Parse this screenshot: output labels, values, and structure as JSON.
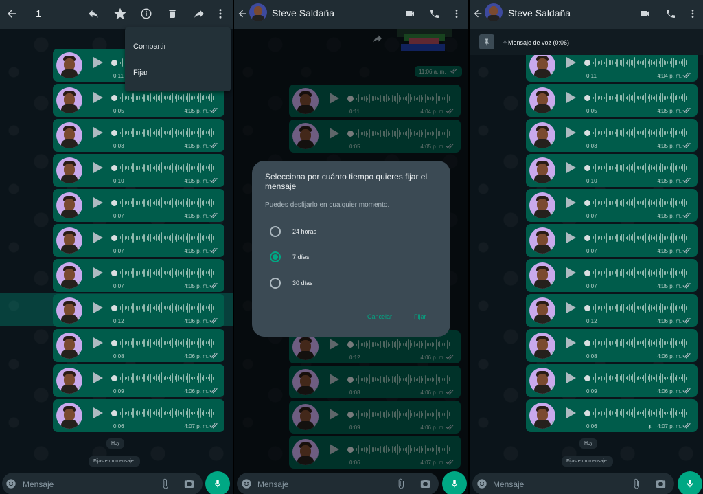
{
  "panel1": {
    "selected_count": "1",
    "menu": {
      "share": "Compartir",
      "pin": "Fijar"
    },
    "messages": [
      {
        "duration": "0:11",
        "time": ""
      },
      {
        "duration": "0:05",
        "time": "4:05 p. m."
      },
      {
        "duration": "0:03",
        "time": "4:05 p. m."
      },
      {
        "duration": "0:10",
        "time": "4:05 p. m."
      },
      {
        "duration": "0:07",
        "time": "4:05 p. m."
      },
      {
        "duration": "0:07",
        "time": "4:05 p. m."
      },
      {
        "duration": "0:07",
        "time": "4:05 p. m."
      },
      {
        "duration": "0:12",
        "time": "4:06 p. m."
      },
      {
        "duration": "0:08",
        "time": "4:06 p. m."
      },
      {
        "duration": "0:09",
        "time": "4:06 p. m."
      },
      {
        "duration": "0:06",
        "time": "4:07 p. m."
      }
    ],
    "date_pill": "Hoy",
    "system_message": "Fijaste un mensaje.",
    "input_placeholder": "Mensaje"
  },
  "panel2": {
    "contact_name": "Steve Saldaña",
    "image_time": "11:06 a. m.",
    "messages": [
      {
        "duration": "0:11",
        "time": "4:04 p. m."
      },
      {
        "duration": "0:05",
        "time": "4:05 p. m."
      },
      {
        "duration": "0:12",
        "time": "4:06 p. m."
      },
      {
        "duration": "0:08",
        "time": "4:06 p. m."
      },
      {
        "duration": "0:09",
        "time": "4:06 p. m."
      },
      {
        "duration": "0:06",
        "time": "4:07 p. m."
      }
    ],
    "dialog": {
      "title": "Selecciona por cuánto tiempo quieres fijar el mensaje",
      "subtitle": "Puedes desfijarlo en cualquier momento.",
      "options": [
        "24 horas",
        "7 días",
        "30 días"
      ],
      "selected_index": 1,
      "cancel": "Cancelar",
      "confirm": "Fijar"
    },
    "input_placeholder": "Mensaje"
  },
  "panel3": {
    "contact_name": "Steve Saldaña",
    "pinned_label": "Mensaje de voz (0:06)",
    "messages": [
      {
        "duration": "0:11",
        "time": "4:04 p. m."
      },
      {
        "duration": "0:05",
        "time": "4:05 p. m."
      },
      {
        "duration": "0:03",
        "time": "4:05 p. m."
      },
      {
        "duration": "0:10",
        "time": "4:05 p. m."
      },
      {
        "duration": "0:07",
        "time": "4:05 p. m."
      },
      {
        "duration": "0:07",
        "time": "4:05 p. m."
      },
      {
        "duration": "0:07",
        "time": "4:05 p. m."
      },
      {
        "duration": "0:12",
        "time": "4:06 p. m."
      },
      {
        "duration": "0:08",
        "time": "4:06 p. m."
      },
      {
        "duration": "0:09",
        "time": "4:06 p. m."
      },
      {
        "duration": "0:06",
        "time": "4:07 p. m."
      }
    ],
    "date_pill": "Hoy",
    "system_message": "Fijaste un mensaje.",
    "input_placeholder": "Mensaje"
  },
  "colors": {
    "bubble": "#005c4b",
    "header": "#202c33",
    "accent": "#00a884",
    "background": "#0b141a"
  }
}
